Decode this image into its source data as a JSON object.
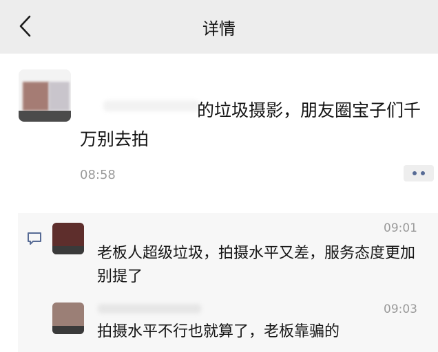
{
  "header": {
    "title": "详情",
    "back_icon": "chevron-left-icon"
  },
  "post": {
    "text": "的垃圾摄影，朋友圈宝子们千万别去拍",
    "time": "08:58",
    "more_icon": "more-dots-icon"
  },
  "comments": {
    "icon": "comment-icon",
    "items": [
      {
        "time": "09:01",
        "text": "老板人超级垃圾，拍摄水平又差，服务态度更加别提了"
      },
      {
        "time": "09:03",
        "text": "拍摄水平不行也就算了，老板靠骗的"
      }
    ]
  },
  "colors": {
    "header_bg": "#ededed",
    "comments_bg": "#f7f7f7",
    "link_blue": "#576b95",
    "meta_grey": "#9a9a9a"
  }
}
